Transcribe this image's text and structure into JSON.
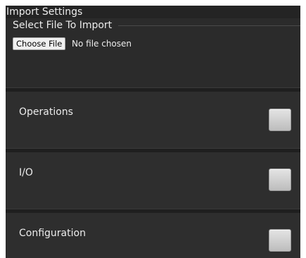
{
  "panel": {
    "title": "Import Settings"
  },
  "file_import": {
    "legend": "Select File To Import",
    "choose_button": "Choose File",
    "status": "No file chosen"
  },
  "rows": [
    {
      "label": "Operations",
      "checked": false
    },
    {
      "label": "I/O",
      "checked": false
    },
    {
      "label": "Configuration",
      "checked": false
    }
  ]
}
